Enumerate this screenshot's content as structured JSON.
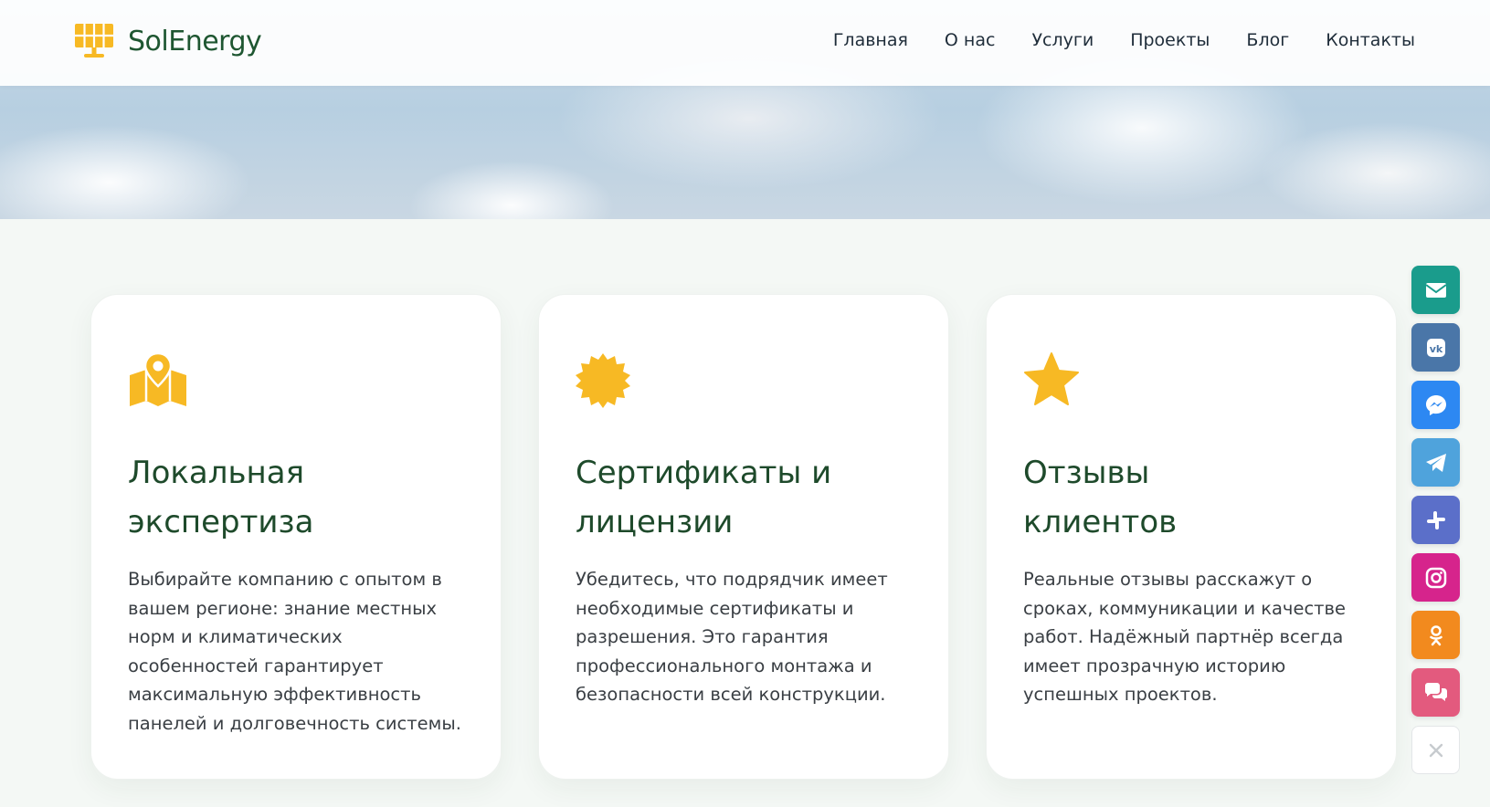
{
  "header": {
    "logo_text": "SolEnergy",
    "nav": [
      "Главная",
      "О нас",
      "Услуги",
      "Проекты",
      "Блог",
      "Контакты"
    ]
  },
  "cards": [
    {
      "icon": "map-pin-icon",
      "title_line1": "Локальная",
      "title_line2": "экспертиза",
      "text": "Выбирайте компанию с опытом в вашем регионе: знание местных норм и климатических особенностей гарантирует максимальную эффективность панелей и долговечность системы."
    },
    {
      "icon": "certificate-icon",
      "title_line1": "Сертификаты и",
      "title_line2": "лицензии",
      "text": "Убедитесь, что подрядчик имеет необходимые сертификаты и разрешения. Это гарантия профессионального монтажа и безопасности всей конструкции."
    },
    {
      "icon": "star-icon",
      "title_line1": "Отзывы",
      "title_line2": "клиентов",
      "text": "Реальные отзывы расскажут о сроках, коммуникации и качестве работ. Надёжный партнёр всегда имеет прозрачную историю успешных проектов."
    }
  ],
  "social": [
    {
      "name": "email-icon",
      "color": "#1a9c8c"
    },
    {
      "name": "vk-icon",
      "color": "#4a76a8"
    },
    {
      "name": "messenger-icon",
      "color": "#2d88f2"
    },
    {
      "name": "telegram-icon",
      "color": "#4fa3dc"
    },
    {
      "name": "slack-icon",
      "color": "#5b6fc9"
    },
    {
      "name": "instagram-icon",
      "color": "#d6248c"
    },
    {
      "name": "odnoklassniki-icon",
      "color": "#f28a1e"
    },
    {
      "name": "chat-icon",
      "color": "#e35a7e"
    },
    {
      "name": "close-icon",
      "color": "#ffffff"
    }
  ],
  "colors": {
    "accent": "#f7b924",
    "heading": "#1e4a2b",
    "brand": "#1e5631"
  }
}
